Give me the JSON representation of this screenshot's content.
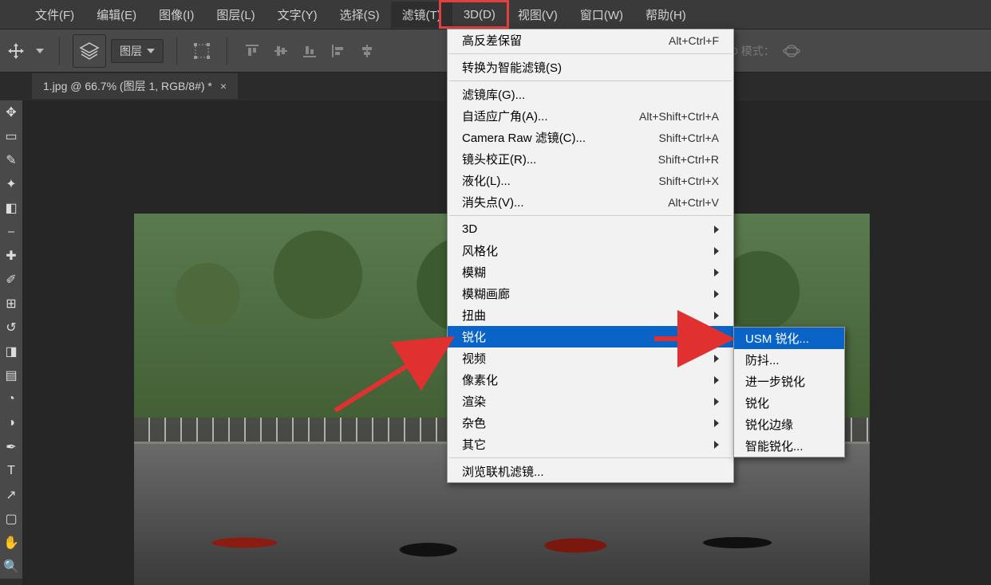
{
  "menubar": {
    "items": [
      {
        "label": "文件(F)"
      },
      {
        "label": "编辑(E)"
      },
      {
        "label": "图像(I)"
      },
      {
        "label": "图层(L)"
      },
      {
        "label": "文字(Y)"
      },
      {
        "label": "选择(S)"
      },
      {
        "label": "滤镜(T)"
      },
      {
        "label": "3D(D)"
      },
      {
        "label": "视图(V)"
      },
      {
        "label": "窗口(W)"
      },
      {
        "label": "帮助(H)"
      }
    ]
  },
  "optionsbar": {
    "layer_dropdown_label": "图层",
    "mode_3d_label": "3D 模式："
  },
  "document_tab": {
    "title": "1.jpg @ 66.7% (图层 1, RGB/8#) *"
  },
  "filter_menu": {
    "last_filter": {
      "label": "高反差保留",
      "shortcut": "Alt+Ctrl+F"
    },
    "convert_smart": "转换为智能滤镜(S)",
    "gallery": "滤镜库(G)...",
    "adaptive_wide": {
      "label": "自适应广角(A)...",
      "shortcut": "Alt+Shift+Ctrl+A"
    },
    "camera_raw": {
      "label": "Camera Raw 滤镜(C)...",
      "shortcut": "Shift+Ctrl+A"
    },
    "lens_correction": {
      "label": "镜头校正(R)...",
      "shortcut": "Shift+Ctrl+R"
    },
    "liquify": {
      "label": "液化(L)...",
      "shortcut": "Shift+Ctrl+X"
    },
    "vanishing_point": {
      "label": "消失点(V)...",
      "shortcut": "Alt+Ctrl+V"
    },
    "cat_3d": "3D",
    "cat_stylize": "风格化",
    "cat_blur": "模糊",
    "cat_blur_gallery": "模糊画廊",
    "cat_distort": "扭曲",
    "cat_sharpen": "锐化",
    "cat_video": "视频",
    "cat_pixelate": "像素化",
    "cat_render": "渲染",
    "cat_noise": "杂色",
    "cat_other": "其它",
    "browse_online": "浏览联机滤镜..."
  },
  "sharpen_submenu": {
    "usm": "USM 锐化...",
    "shake_reduction": "防抖...",
    "sharpen_more": "进一步锐化",
    "sharpen": "锐化",
    "sharpen_edges": "锐化边缘",
    "smart_sharpen": "智能锐化..."
  }
}
